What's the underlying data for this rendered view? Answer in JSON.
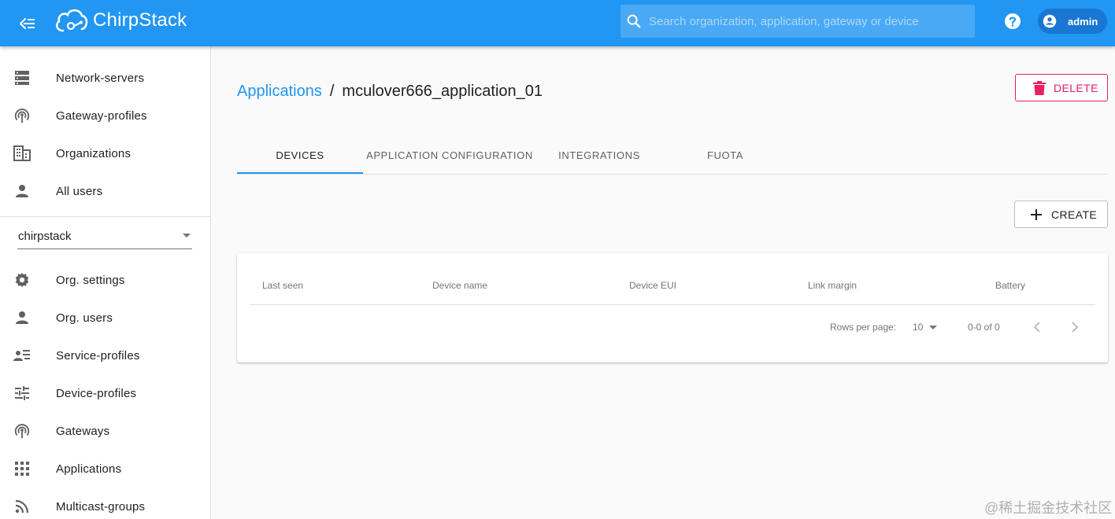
{
  "header": {
    "app_name": "ChirpStack",
    "search_placeholder": "Search organization, application, gateway or device",
    "user_name": "admin"
  },
  "sidebar": {
    "global_items": [
      {
        "label": "Network-servers",
        "icon": "server-icon"
      },
      {
        "label": "Gateway-profiles",
        "icon": "gateway-icon"
      },
      {
        "label": "Organizations",
        "icon": "building-icon"
      },
      {
        "label": "All users",
        "icon": "person-icon"
      }
    ],
    "org_select_value": "chirpstack",
    "org_items": [
      {
        "label": "Org. settings",
        "icon": "gear-icon"
      },
      {
        "label": "Org. users",
        "icon": "person-icon"
      },
      {
        "label": "Service-profiles",
        "icon": "account-details-icon"
      },
      {
        "label": "Device-profiles",
        "icon": "tune-icon"
      },
      {
        "label": "Gateways",
        "icon": "gateway-icon"
      },
      {
        "label": "Applications",
        "icon": "apps-icon"
      },
      {
        "label": "Multicast-groups",
        "icon": "rss-icon"
      }
    ]
  },
  "breadcrumb": {
    "parent": "Applications",
    "separator": "/",
    "current": "mculover666_application_01"
  },
  "actions": {
    "delete_label": "DELETE",
    "create_label": "CREATE"
  },
  "tabs": [
    "DEVICES",
    "APPLICATION CONFIGURATION",
    "INTEGRATIONS",
    "FUOTA"
  ],
  "active_tab": "DEVICES",
  "table": {
    "columns": [
      "Last seen",
      "Device name",
      "Device EUI",
      "Link margin",
      "Battery"
    ],
    "rows": [],
    "rows_per_page_label": "Rows per page:",
    "rows_per_page_value": "10",
    "range_label": "0-0 of 0"
  },
  "colors": {
    "primary": "#2196f3",
    "danger": "#e91e63"
  },
  "watermark": "@稀土掘金技术社区"
}
